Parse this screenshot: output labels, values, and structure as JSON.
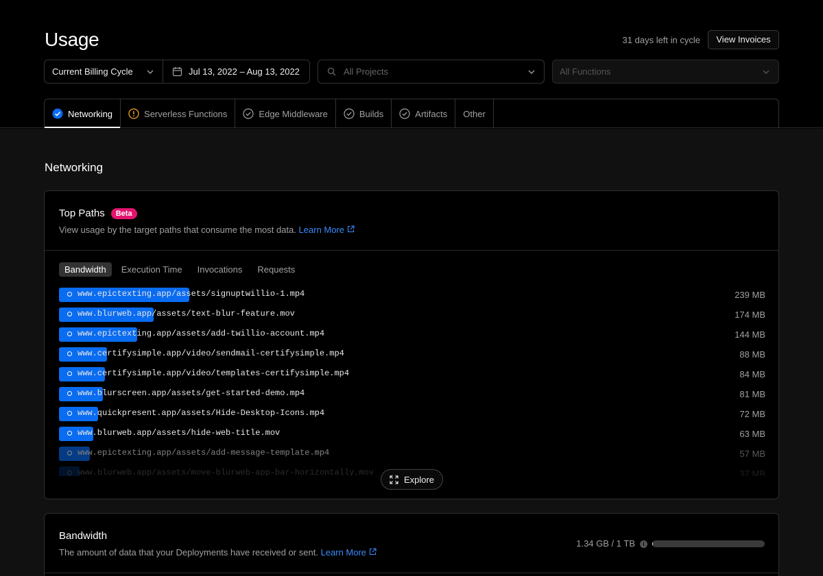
{
  "header": {
    "title": "Usage",
    "cycle_remaining": "31 days left in cycle",
    "view_invoices": "View Invoices"
  },
  "filters": {
    "billing_cycle": "Current Billing Cycle",
    "date_range": "Jul 13, 2022 – Aug 13, 2022",
    "projects_placeholder": "All Projects",
    "functions_placeholder": "All Functions"
  },
  "tabs": [
    {
      "label": "Networking",
      "status": "ok",
      "active": true
    },
    {
      "label": "Serverless Functions",
      "status": "warning",
      "active": false
    },
    {
      "label": "Edge Middleware",
      "status": "ok",
      "active": false
    },
    {
      "label": "Builds",
      "status": "ok",
      "active": false
    },
    {
      "label": "Artifacts",
      "status": "ok",
      "active": false
    },
    {
      "label": "Other",
      "status": "none",
      "active": false
    }
  ],
  "colors": {
    "accent_blue": "#0a6cf1",
    "link_blue": "#3b8bff",
    "beta_pink": "#e5136e",
    "warning_orange": "#f5a623"
  },
  "section": {
    "title": "Networking"
  },
  "top_paths": {
    "title": "Top Paths",
    "badge": "Beta",
    "subtitle": "View usage by the target paths that consume the most data.",
    "learn_more": "Learn More",
    "subtabs": [
      "Bandwidth",
      "Execution Time",
      "Invocations",
      "Requests"
    ],
    "rows": [
      {
        "path": "www.epictexting.app/assets/signuptwillio-1.mp4",
        "size": "239 MB",
        "mb": 239
      },
      {
        "path": "www.blurweb.app/assets/text-blur-feature.mov",
        "size": "174 MB",
        "mb": 174
      },
      {
        "path": "www.epictexting.app/assets/add-twillio-account.mp4",
        "size": "144 MB",
        "mb": 144
      },
      {
        "path": "www.certifysimple.app/video/sendmail-certifysimple.mp4",
        "size": "88 MB",
        "mb": 88
      },
      {
        "path": "www.certifysimple.app/video/templates-certifysimple.mp4",
        "size": "84 MB",
        "mb": 84
      },
      {
        "path": "www.blurscreen.app/assets/get-started-demo.mp4",
        "size": "81 MB",
        "mb": 81
      },
      {
        "path": "www.quickpresent.app/assets/Hide-Desktop-Icons.mp4",
        "size": "72 MB",
        "mb": 72
      },
      {
        "path": "www.blurweb.app/assets/hide-web-title.mov",
        "size": "63 MB",
        "mb": 63
      },
      {
        "path": "www.epictexting.app/assets/add-message-template.mp4",
        "size": "57 MB",
        "mb": 57
      },
      {
        "path": "www.blurweb.app/assets/move-blurweb-app-bar-horizontally.mov",
        "size": "37 MB",
        "mb": 37
      }
    ],
    "explore": "Explore"
  },
  "bandwidth": {
    "title": "Bandwidth",
    "subtitle": "The amount of data that your Deployments have received or sent.",
    "learn_more": "Learn More",
    "usage": "1.34 GB / 1 TB",
    "usage_fraction": 0.00134
  }
}
